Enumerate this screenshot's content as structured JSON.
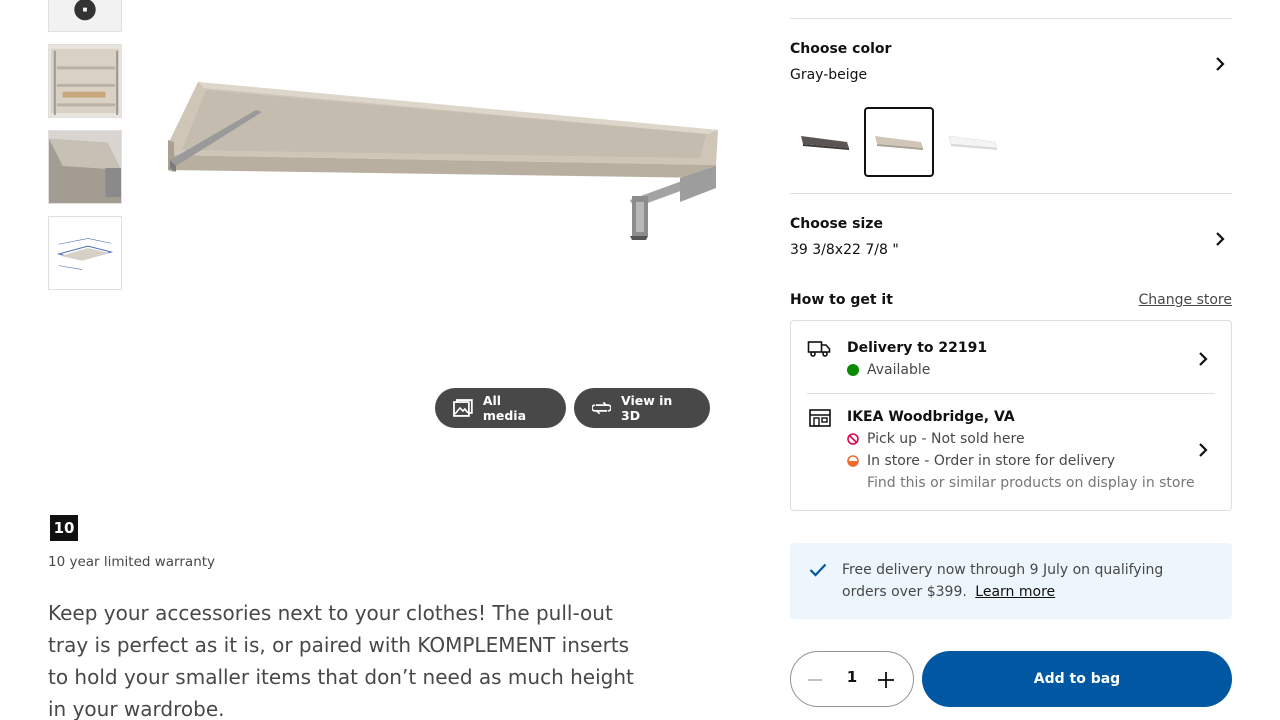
{
  "gallery": {
    "all_media_label": "All media",
    "view_3d_label": "View in 3D"
  },
  "warranty": {
    "badge": "10",
    "text": "10 year limited warranty"
  },
  "description": "Keep your accessories next to your clothes! The pull-out tray is perfect as it is, or paired with KOMPLEMENT inserts to hold your smaller items that don’t need as much height in your wardrobe.",
  "color": {
    "title": "Choose color",
    "value": "Gray-beige",
    "swatches": [
      {
        "name": "Dark gray",
        "color": "#5a5553",
        "selected": false
      },
      {
        "name": "Gray-beige",
        "color": "#cfc6b8",
        "selected": true
      },
      {
        "name": "White",
        "color": "#f2f2f2",
        "selected": false
      }
    ]
  },
  "size": {
    "title": "Choose size",
    "value": "39 3/8x22 7/8 \""
  },
  "how_to_get": {
    "title": "How to get it",
    "change_store": "Change store",
    "delivery": {
      "title": "Delivery to 22191",
      "status": "Available",
      "status_color": "#0a8a00"
    },
    "store": {
      "title": "IKEA Woodbridge, VA",
      "pickup": "Pick up - Not sold here",
      "pickup_color": "#e00751",
      "instore": "In store - Order in store for delivery",
      "instore_color": "#f26a2e",
      "display_note": "Find this or similar products on display in store"
    }
  },
  "promo": {
    "text": "Free delivery now through 9 July on qualifying orders over $399.",
    "link": "Learn more"
  },
  "purchase": {
    "quantity": "1",
    "add_to_bag": "Add to bag"
  },
  "colors": {
    "primary_blue": "#0058a3",
    "promo_bg": "#edf6fc",
    "button_dark": "#484848"
  }
}
